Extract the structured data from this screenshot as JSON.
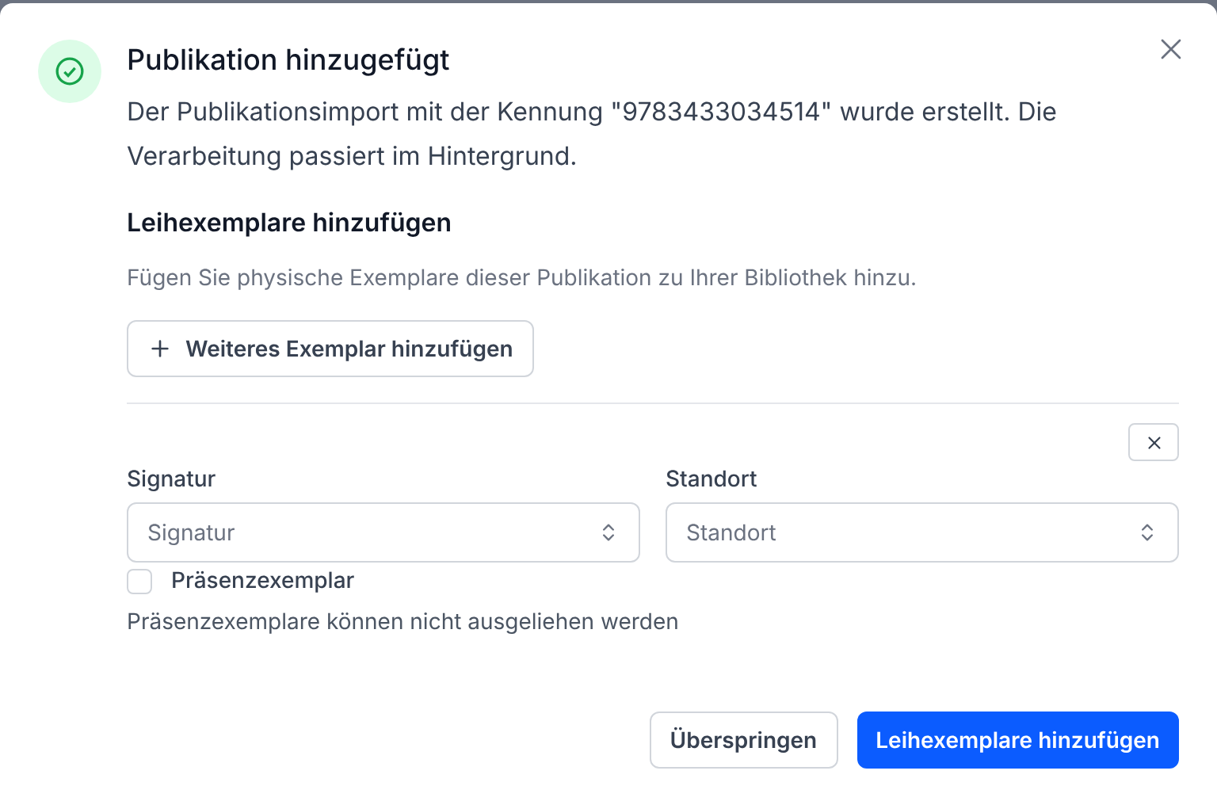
{
  "dialog": {
    "title": "Publikation hinzugefügt",
    "message": "Der Publikationsimport mit der Kennung \"9783433034514\" wurde erstellt. Die Verarbeitung passiert im Hintergrund.",
    "section_title": "Leihexemplare hinzufügen",
    "section_description": "Fügen Sie physische Exemplare dieser Publikation zu Ihrer Bibliothek hinzu.",
    "add_button": "Weiteres Exemplar hinzufügen",
    "copy": {
      "fields": [
        {
          "label": "Signatur",
          "placeholder": "Signatur"
        },
        {
          "label": "Standort",
          "placeholder": "Standort"
        }
      ],
      "checkbox": {
        "label": "Präsenzexemplar",
        "checked": false
      },
      "hint": "Präsenzexemplare können nicht ausgeliehen werden"
    },
    "buttons": [
      {
        "label": "Überspringen",
        "kind": "secondary"
      },
      {
        "label": "Leihexemplare hinzufügen",
        "kind": "primary"
      }
    ]
  }
}
